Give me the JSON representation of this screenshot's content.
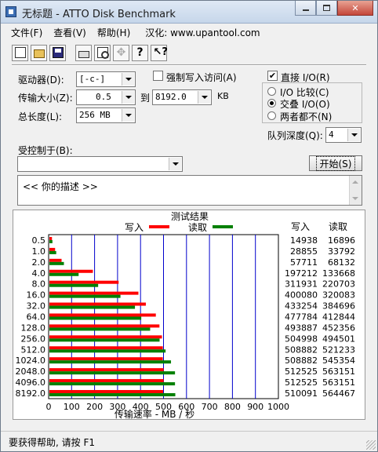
{
  "window": {
    "title": "无标题 - ATTO Disk Benchmark"
  },
  "menu": {
    "file": "文件(F)",
    "view": "查看(V)",
    "help": "帮助(H)",
    "credit": "汉化: www.upantool.com"
  },
  "toolbar_icons": [
    "new-icon",
    "open-icon",
    "save-icon",
    "print-icon",
    "print-preview-icon",
    "move-icon",
    "help-icon",
    "context-help-icon"
  ],
  "form": {
    "drive_label": "驱动器(D):",
    "drive_value": "[-c-]",
    "force_write_label": "强制写入访问(A)",
    "force_write_checked": false,
    "transfer_size_label": "传输大小(Z):",
    "transfer_from": "0.5",
    "to_label": "到",
    "transfer_to": "8192.0",
    "kb_unit": "KB",
    "total_length_label": "总长度(L):",
    "total_length_value": "256 MB",
    "direct_io_label": "直接 I/O(R)",
    "direct_io_checked": true,
    "io_compare_label": "I/O 比较(C)",
    "overlapped_io_label": "交叠 I/O(O)",
    "neither_label": "两者都不(N)",
    "io_mode_selected": "overlapped",
    "queue_depth_label": "队列深度(Q):",
    "queue_depth_value": "4",
    "controlled_by_label": "受控制于(B):",
    "controlled_by_value": "",
    "start_button": "开始(S)",
    "description_text": "<<   你的描述    >>"
  },
  "results": {
    "title": "测试结果",
    "write_legend": "写入",
    "read_legend": "读取",
    "write_column_header": "写入",
    "read_column_header": "读取",
    "xlabel": "传输速率 - MB / 秒",
    "write_color": "#ff0000",
    "read_color": "#008000",
    "grid_color": "#0000cc"
  },
  "chart_data": {
    "type": "bar",
    "orientation": "horizontal",
    "categories": [
      "0.5",
      "1.0",
      "2.0",
      "4.0",
      "8.0",
      "16.0",
      "32.0",
      "64.0",
      "128.0",
      "256.0",
      "512.0",
      "1024.0",
      "2048.0",
      "4096.0",
      "8192.0"
    ],
    "series": [
      {
        "name": "写入",
        "values": [
          14938,
          28855,
          57711,
          197212,
          311931,
          400080,
          433254,
          477784,
          493887,
          504998,
          508882,
          508882,
          512525,
          512525,
          510091
        ]
      },
      {
        "name": "读取",
        "values": [
          16896,
          33792,
          68132,
          133668,
          220703,
          320083,
          384696,
          412844,
          452356,
          494501,
          521233,
          545354,
          563151,
          563151,
          564467
        ]
      }
    ],
    "x_ticks": [
      "0",
      "100",
      "200",
      "300",
      "400",
      "500",
      "600",
      "700",
      "800",
      "900",
      "1000"
    ],
    "xlim": [
      0,
      1000
    ],
    "xlabel": "传输速率 - MB / 秒",
    "grid": true,
    "legend": "top"
  },
  "status": {
    "text": "要获得帮助, 请按 F1"
  }
}
